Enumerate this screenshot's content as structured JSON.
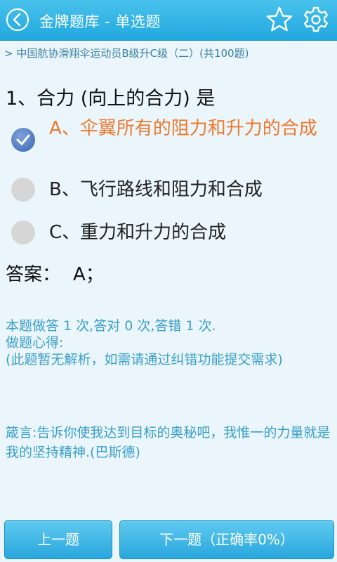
{
  "header": {
    "title": "金牌题库 - 单选题",
    "icons": {
      "back": "back-arrow-icon",
      "favorite": "star-icon",
      "settings": "gear-icon"
    }
  },
  "breadcrumb": "> 中国航协滑翔伞运动员B级升C级（二）(共100题)",
  "question": {
    "text": "1、合力 (向上的合力) 是",
    "options": [
      {
        "label": "A、伞翼所有的阻力和升力的合成",
        "selected": true
      },
      {
        "label": "B、飞行路线和阻力和合成",
        "selected": false
      },
      {
        "label": "C、重力和升力的合成",
        "selected": false
      }
    ]
  },
  "answer": {
    "label": "答案：",
    "value": "A；"
  },
  "stats": {
    "record": "本题做答 1 次,答对 0 次,答错 1 次.",
    "notes_label": "做题心得:",
    "notes": "(此题暂无解析，如需请通过纠错功能提交需求)"
  },
  "motto": "箴言:告诉你使我达到目标的奥秘吧，我惟一的力量就是我的坚持精神.(巴斯德)",
  "buttons": {
    "prev": "上一题",
    "next": "下一题（正确率0%）"
  },
  "colors": {
    "header": "#22a8e0",
    "selected_option": "#ee7a2e",
    "info_text": "#3b9ec9",
    "background": "#eaf6fb"
  }
}
